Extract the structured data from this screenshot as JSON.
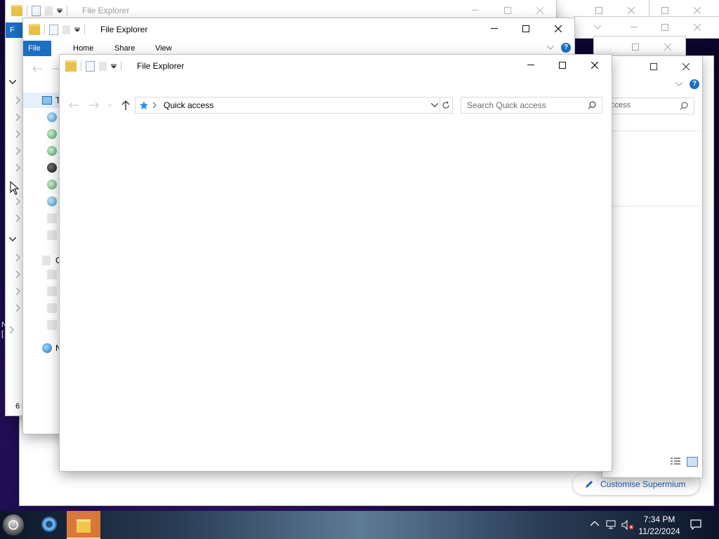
{
  "windows": {
    "title": "File Explorer",
    "ribbon": {
      "file": "File",
      "home": "Home",
      "share": "Share",
      "view": "View"
    }
  },
  "address": {
    "location": "Quick access"
  },
  "search": {
    "placeholder": "Search Quick access",
    "partial_placeholder": "ccess"
  },
  "back_window": {
    "status_partial": "6 i",
    "tree_letter_t": "T",
    "tree_letter_c": "C",
    "tree_letter_n": "N"
  },
  "desktop": {
    "text_n": "N",
    "text_bracket": "["
  },
  "customise": {
    "label": "Customise Supermium"
  },
  "taskbar": {
    "time": "7:34 PM",
    "date": "11/22/2024"
  },
  "colors": {
    "accent": "#1a6fc4",
    "file_tab": "#1a6fc4",
    "link_blue": "#1c5fbf"
  }
}
